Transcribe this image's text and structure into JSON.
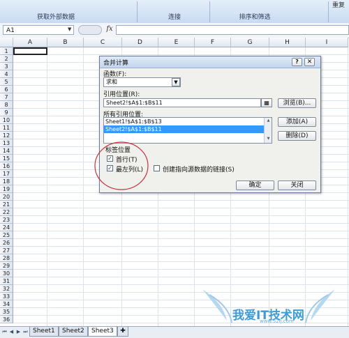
{
  "ribbon": {
    "groups": [
      "获取外部数据",
      "连接",
      "排序和筛选"
    ],
    "right_label": "重复"
  },
  "formula_bar": {
    "name_box": "A1",
    "fx": "fx",
    "formula": ""
  },
  "grid": {
    "columns": [
      "A",
      "B",
      "C",
      "D",
      "E",
      "F",
      "G",
      "H",
      "I"
    ],
    "rows": [
      "1",
      "2",
      "3",
      "4",
      "5",
      "6",
      "7",
      "8",
      "9",
      "10",
      "11",
      "12",
      "13",
      "14",
      "15",
      "16",
      "17",
      "18",
      "19",
      "20",
      "21",
      "22",
      "23",
      "24",
      "25",
      "26",
      "27",
      "28",
      "29",
      "30",
      "31",
      "32",
      "33",
      "34",
      "35",
      "36"
    ]
  },
  "sheet_tabs": {
    "tabs": [
      "Sheet1",
      "Sheet2",
      "Sheet3"
    ],
    "active": "Sheet3"
  },
  "dialog": {
    "title": "合并计算",
    "function_label": "函数(F):",
    "function_value": "求和",
    "ref_label": "引用位置(R):",
    "ref_value": "Sheet2!$A$1:$B$11",
    "browse_label": "浏览(B)...",
    "all_refs_label": "所有引用位置:",
    "all_refs": [
      "Sheet1!$A$1:$B$13",
      "Sheet2!$A$1:$B$11"
    ],
    "selected_ref_index": 1,
    "add_label": "添加(A)",
    "delete_label": "删除(D)",
    "label_group": "标签位置",
    "top_row_label": "首行(T)",
    "top_row_checked": true,
    "left_col_label": "最左列(L)",
    "left_col_checked": true,
    "link_label": "创建指向源数据的链接(S)",
    "link_checked": false,
    "ok_label": "确定",
    "close_label": "关闭"
  },
  "watermark": {
    "text": "我爱IT技术网",
    "url": "www.52ij.com"
  },
  "colors": {
    "selection": "#3399ff",
    "annotation_circle": "#c8323c",
    "watermark": "#3d9bd6"
  }
}
